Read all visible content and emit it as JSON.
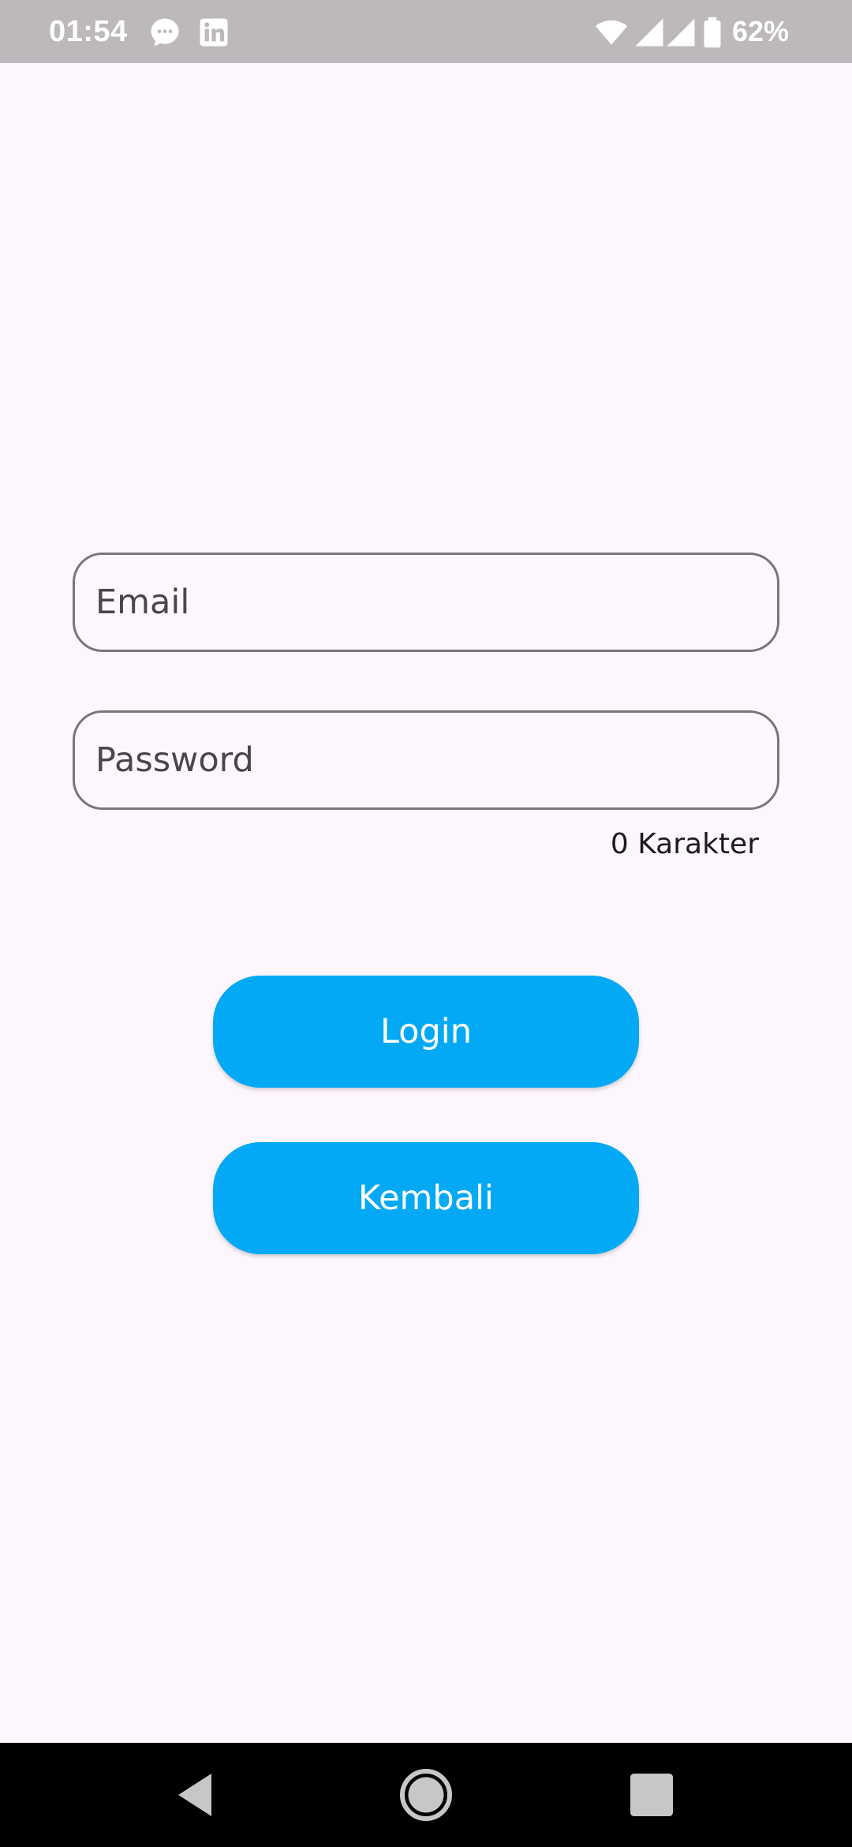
{
  "status_bar": {
    "time": "01:54",
    "battery": "62%",
    "icons": [
      "chat-bubble-icon",
      "linkedin-icon",
      "wifi-icon",
      "signal-icon",
      "signal-icon",
      "battery-icon"
    ]
  },
  "form": {
    "email": {
      "placeholder": "Email",
      "value": ""
    },
    "password": {
      "placeholder": "Password",
      "value": ""
    },
    "char_counter": "0 Karakter"
  },
  "buttons": {
    "login": "Login",
    "back": "Kembali"
  },
  "nav_bar": {
    "icons": [
      "back-icon",
      "home-icon",
      "recents-icon"
    ]
  },
  "colors": {
    "background": "#fdf7fd",
    "status_bar": "#bcb8bc",
    "accent": "#03a9f4",
    "outline": "#79747e"
  }
}
